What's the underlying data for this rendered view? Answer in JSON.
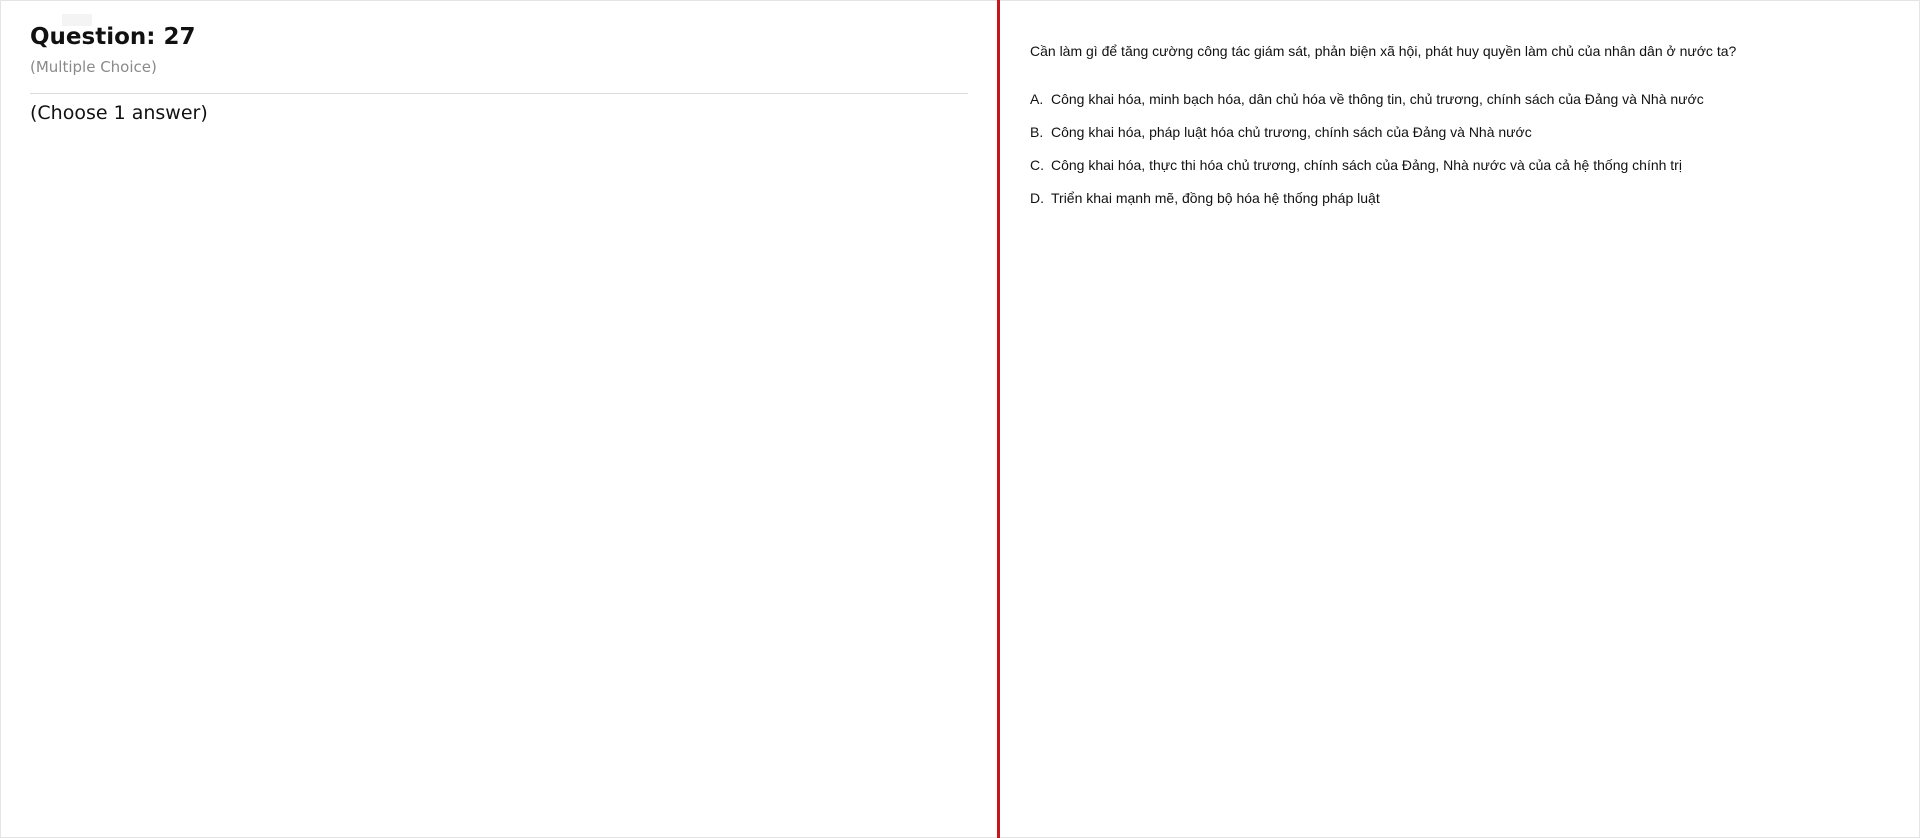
{
  "question": {
    "title": "Question: 27",
    "type": "(Multiple Choice)",
    "instruction": "(Choose 1 answer)",
    "stem": "Cần làm gì để tăng cường công tác giám sát, phản biện xã hội, phát huy quyền làm chủ của nhân dân ở nước ta?",
    "answers": [
      {
        "letter": "A.",
        "text": "Công khai hóa, minh bạch hóa, dân chủ hóa về thông tin, chủ trương, chính sách của Đảng và Nhà nước"
      },
      {
        "letter": "B.",
        "text": "Công khai hóa, pháp luật hóa chủ trương, chính sách của Đảng và Nhà nước"
      },
      {
        "letter": "C.",
        "text": "Công khai hóa, thực thi hóa chủ trương, chính sách của Đảng, Nhà nước và của cả hệ thống chính trị"
      },
      {
        "letter": "D.",
        "text": "Triển khai mạnh mẽ, đồng bộ hóa hệ thống pháp luật"
      }
    ]
  },
  "colors": {
    "splitter": "#c4161c",
    "muted_text": "#8a8a8a",
    "divider": "#dcdcdc"
  }
}
